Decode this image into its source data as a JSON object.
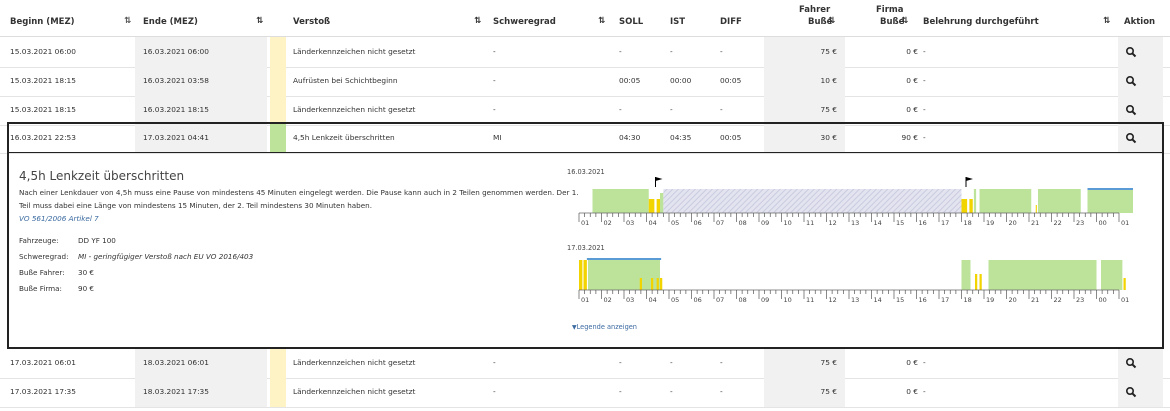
{
  "headers": {
    "beginn": "Beginn (MEZ)",
    "ende": "Ende (MEZ)",
    "verstoss": "Verstoß",
    "schweregrad": "Schweregrad",
    "soll": "SOLL",
    "ist": "IST",
    "diff": "DIFF",
    "fahrer_l1": "Fahrer",
    "fahrer_l2": "Buße",
    "firma_l1": "Firma",
    "firma_l2": "Buße",
    "belehrung": "Belehrung durchgeführt",
    "aktion": "Aktion"
  },
  "rows": [
    {
      "beginn": "15.03.2021 06:00",
      "ende": "16.03.2021 06:00",
      "verstoss": "Länderkennzeichen nicht gesetzt",
      "schweregrad": "-",
      "soll": "-",
      "ist": "-",
      "diff": "-",
      "fahrer": "75 €",
      "firma": "0 €",
      "belehrung": "-",
      "band": "#fdf3c4"
    },
    {
      "beginn": "15.03.2021 18:15",
      "ende": "16.03.2021 03:58",
      "verstoss": "Aufrüsten bei Schichtbeginn",
      "schweregrad": "-",
      "soll": "00:05",
      "ist": "00:00",
      "diff": "00:05",
      "fahrer": "10 €",
      "firma": "0 €",
      "belehrung": "-",
      "band": "#fdf3c4"
    },
    {
      "beginn": "15.03.2021 18:15",
      "ende": "16.03.2021 18:15",
      "verstoss": "Länderkennzeichen nicht gesetzt",
      "schweregrad": "-",
      "soll": "-",
      "ist": "-",
      "diff": "-",
      "fahrer": "75 €",
      "firma": "0 €",
      "belehrung": "-",
      "band": "#fdf3c4"
    },
    {
      "beginn": "16.03.2021 22:53",
      "ende": "17.03.2021 04:41",
      "verstoss": "4,5h Lenkzeit überschritten",
      "schweregrad": "MI",
      "soll": "04:30",
      "ist": "04:35",
      "diff": "00:05",
      "fahrer": "30 €",
      "firma": "90 €",
      "belehrung": "-",
      "band": "#bde39b"
    },
    {
      "beginn": "17.03.2021 06:01",
      "ende": "18.03.2021 06:01",
      "verstoss": "Länderkennzeichen nicht gesetzt",
      "schweregrad": "-",
      "soll": "-",
      "ist": "-",
      "diff": "-",
      "fahrer": "75 €",
      "firma": "0 €",
      "belehrung": "-",
      "band": "#fdf3c4"
    },
    {
      "beginn": "17.03.2021 17:35",
      "ende": "18.03.2021 17:35",
      "verstoss": "Länderkennzeichen nicht gesetzt",
      "schweregrad": "-",
      "soll": "-",
      "ist": "-",
      "diff": "-",
      "fahrer": "75 €",
      "firma": "0 €",
      "belehrung": "-",
      "band": "#fdf3c4"
    }
  ],
  "detail": {
    "title": "4,5h Lenkzeit überschritten",
    "desc_line1": "Nach einer Lenkdauer von 4,5h muss eine Pause von mindestens 45 Minuten eingelegt werden. Die Pause kann auch in 2 Teilen genommen werden. Der 1.",
    "desc_line2": "Teil muss dabei eine Länge von mindestens 15 Minuten, der 2. Teil mindestens 30 Minuten haben.",
    "law": "VO 561/2006 Artikel 7",
    "fahrzeuge_label": "Fahrzeuge:",
    "fahrzeuge_value": "DD YF 100",
    "schweregrad_label": "Schweregrad:",
    "schweregrad_value": "MI - geringfügiger Verstoß nach EU VO 2016/403",
    "busse_fahrer_label": "Buße Fahrer:",
    "busse_fahrer_value": "30 €",
    "busse_firma_label": "Buße Firma:",
    "busse_firma_value": "90 €",
    "legend_link": "Legende anzeigen",
    "chart1_date": "16.03.2021",
    "chart2_date": "17.03.2021",
    "hour_labels": [
      "01",
      "02",
      "03",
      "04",
      "05",
      "06",
      "07",
      "08",
      "09",
      "10",
      "11",
      "12",
      "13",
      "14",
      "15",
      "16",
      "17",
      "18",
      "19",
      "20",
      "21",
      "22",
      "23",
      "00",
      "01"
    ]
  },
  "colors": {
    "drive": "#bde39b",
    "yellow": "#f2d400",
    "blue": "#5b9bd5",
    "hatch": "#c9cbe0",
    "band_default": "#fdf3c4"
  },
  "icons": {
    "aktion": "search-icon",
    "legend": "chevron-down-icon",
    "flag": "flag-icon"
  }
}
